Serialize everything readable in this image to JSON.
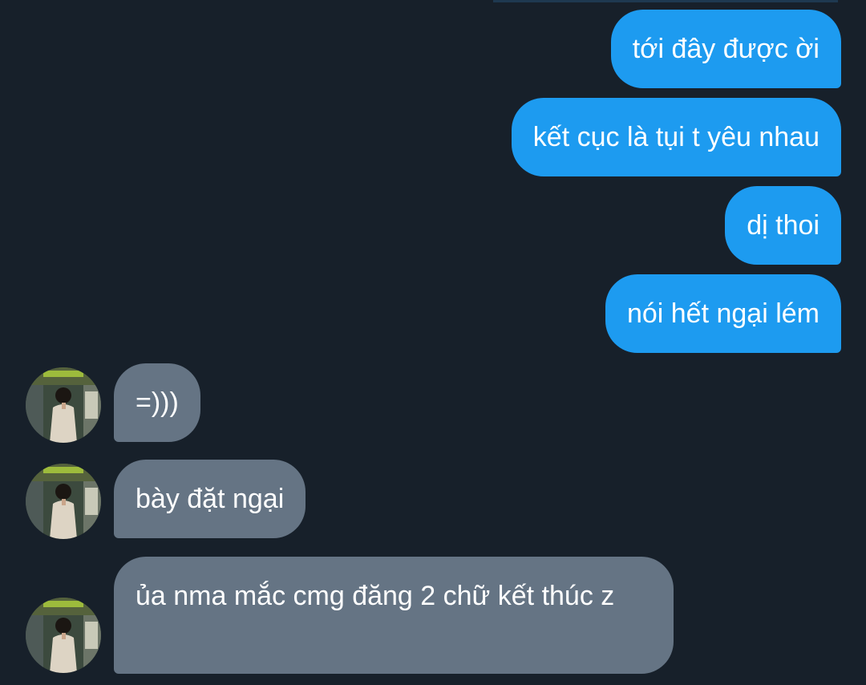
{
  "conversation": {
    "messages": [
      {
        "direction": "outgoing",
        "text": "tới đây được ời"
      },
      {
        "direction": "outgoing",
        "text": "kết cục là tụi t yêu nhau"
      },
      {
        "direction": "outgoing",
        "text": "dị thoi"
      },
      {
        "direction": "outgoing",
        "text": "nói hết ngại lém"
      },
      {
        "direction": "incoming",
        "text": "=)))"
      },
      {
        "direction": "incoming",
        "text": "bày đặt ngại"
      },
      {
        "direction": "incoming",
        "text": "ủa nma mắc cmg đăng 2 chữ kết thúc z"
      }
    ]
  },
  "colors": {
    "background": "#17202a",
    "outgoing_bubble": "#1d9bf0",
    "incoming_bubble": "#657484",
    "text": "#ffffff"
  },
  "icons": {
    "avatar": "contact-avatar-icon"
  }
}
